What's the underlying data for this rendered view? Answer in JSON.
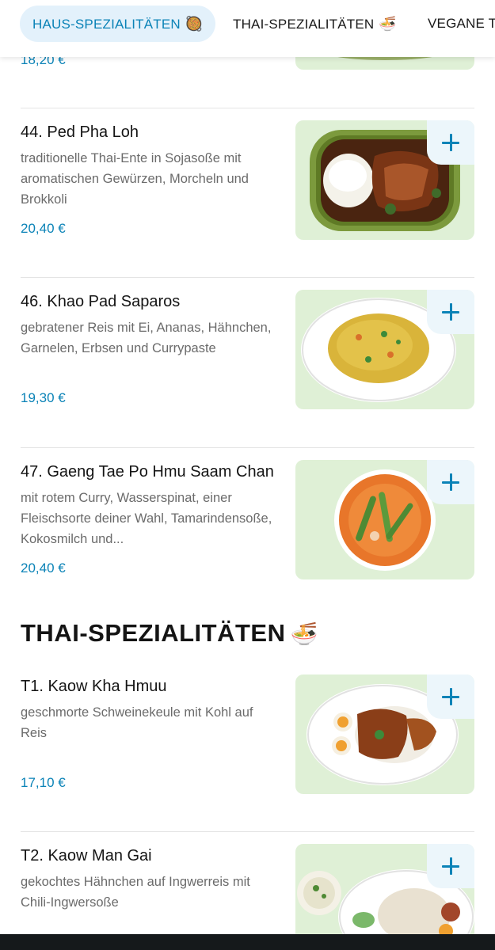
{
  "tabs": [
    {
      "label": "HAUS-SPEZIALITÄTEN",
      "emoji": "🥘",
      "active": true
    },
    {
      "label": "THAI-SPEZIALITÄTEN",
      "emoji": "🍜",
      "active": false
    },
    {
      "label": "VEGANE T",
      "emoji": "",
      "active": false
    }
  ],
  "partial_item": {
    "price": "18,20 €"
  },
  "items": [
    {
      "name": "44. Ped Pha Loh",
      "description": "traditionelle Thai-Ente in Sojasoße mit aromatischen Gewürzen, Morcheln und Brokkoli",
      "price": "20,40 €"
    },
    {
      "name": "46. Khao Pad Saparos",
      "description": "gebratener Reis mit Ei, Ananas, Hähnchen, Garnelen, Erbsen und Currypaste",
      "price": "19,30 €"
    },
    {
      "name": "47. Gaeng Tae Po Hmu Saam Chan",
      "description": "mit rotem Curry, Wasserspinat, einer Fleischsorte deiner Wahl, Tamarindensoße, Kokosmilch und...",
      "price": "20,40 €"
    }
  ],
  "section": {
    "title": "THAI-SPEZIALITÄTEN",
    "emoji": "🍜"
  },
  "thai_items": [
    {
      "name": "T1. Kaow Kha Hmuu",
      "description": "geschmorte Schweinekeule mit Kohl auf Reis",
      "price": "17,10 €"
    },
    {
      "name": "T2. Kaow Man Gai",
      "description": "gekochtes Hähnchen auf Ingwerreis mit Chili-Ingwersoße",
      "price": ""
    }
  ],
  "colors": {
    "accent": "#0b83b7",
    "active_tab_bg": "#e3f1fb",
    "thumb_bg": "#dff0d6"
  }
}
